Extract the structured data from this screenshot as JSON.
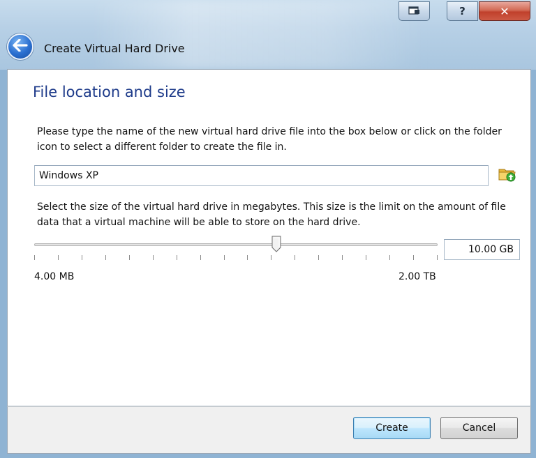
{
  "window": {
    "title": "Create Virtual Hard Drive",
    "caption_buttons": [
      {
        "name": "restore",
        "icon": "restore-icon"
      },
      {
        "name": "help",
        "label": "?"
      },
      {
        "name": "close",
        "label": "✕"
      }
    ]
  },
  "page": {
    "heading": "File location and size",
    "location_description": "Please type the name of the new virtual hard drive file into the box below or click on the folder icon to select a different folder to create the file in.",
    "file_name_value": "Windows XP",
    "folder_icon": "folder-icon",
    "size_description": "Select the size of the virtual hard drive in megabytes. This size is the limit on the amount of file data that a virtual machine will be able to store on the hard drive.",
    "size_slider": {
      "min_label": "4.00 MB",
      "max_label": "2.00 TB",
      "position_fraction": 0.6
    },
    "size_value": "10.00 GB"
  },
  "buttons": {
    "create": "Create",
    "cancel": "Cancel"
  },
  "colors": {
    "heading": "#1e3b8a",
    "default_button_border": "#3c7fb1",
    "close_button": "#c0402c"
  }
}
